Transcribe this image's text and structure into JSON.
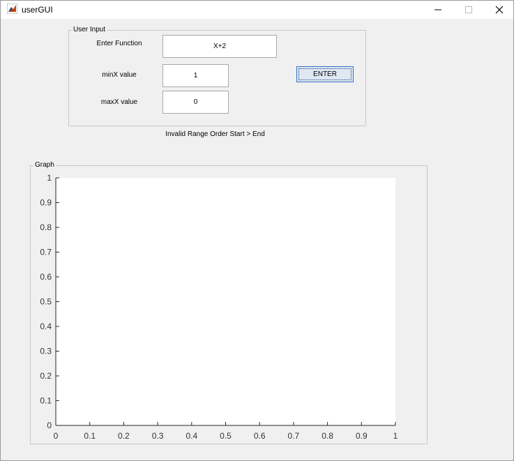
{
  "window": {
    "title": "userGUI",
    "minimize_icon": "minimize-icon",
    "maximize_icon": "maximize-icon",
    "close_icon": "close-icon",
    "app_icon": "matlab-logo-icon"
  },
  "user_input": {
    "panel_title": "User Input",
    "function_label": "Enter Function",
    "function_value": "X+2",
    "minx_label": "minX value",
    "minx_value": "1",
    "maxx_label": "maxX value",
    "maxx_value": "0",
    "enter_button": "ENTER"
  },
  "status_text": "Invalid Range Order Start > End",
  "graph": {
    "panel_title": "Graph"
  },
  "chart_data": {
    "type": "line",
    "series": [],
    "xlim": [
      0,
      1
    ],
    "ylim": [
      0,
      1
    ],
    "xticks": [
      "0",
      "0.1",
      "0.2",
      "0.3",
      "0.4",
      "0.5",
      "0.6",
      "0.7",
      "0.8",
      "0.9",
      "1"
    ],
    "yticks": [
      "0",
      "0.1",
      "0.2",
      "0.3",
      "0.4",
      "0.5",
      "0.6",
      "0.7",
      "0.8",
      "0.9",
      "1"
    ],
    "grid": false,
    "plot_background": "#ffffff"
  }
}
